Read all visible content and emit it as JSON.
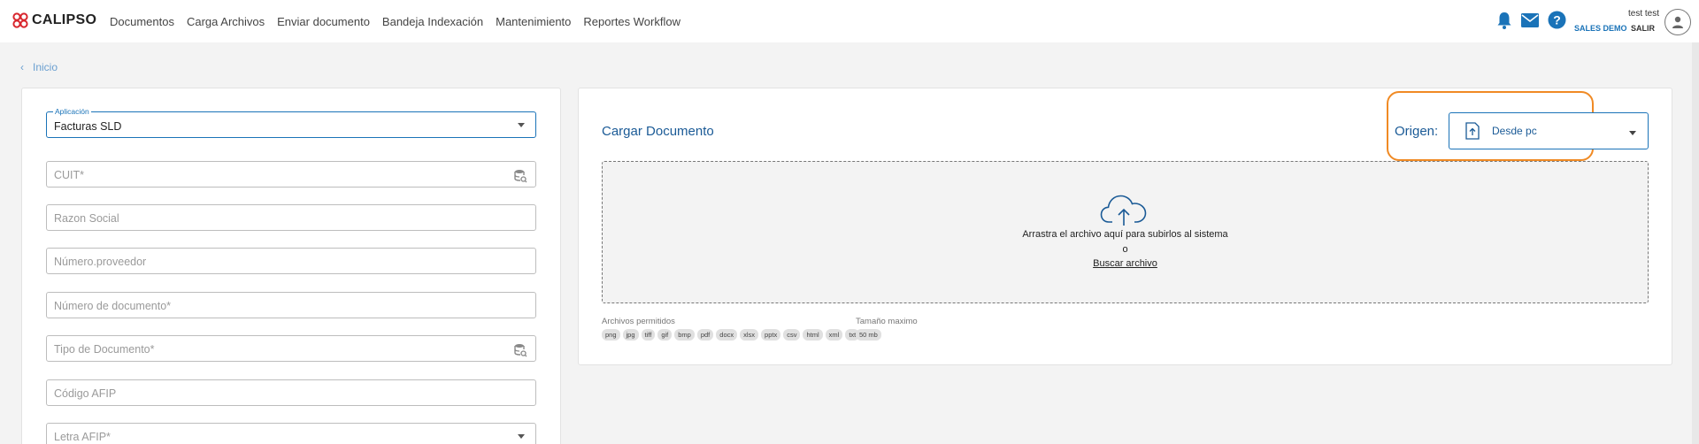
{
  "header": {
    "brand": "CALIPSO",
    "nav": [
      "Documentos",
      "Carga Archivos",
      "Enviar documento",
      "Bandeja Indexación",
      "Mantenimiento",
      "Reportes Workflow"
    ],
    "icons": [
      "bell-icon",
      "mail-icon",
      "help-icon"
    ],
    "user_name": "test test",
    "company": "SALES DEMO",
    "logout": "SALIR",
    "accent_color": "#1a73b8"
  },
  "breadcrumb": {
    "label": "Inicio"
  },
  "form": {
    "application": {
      "label": "Aplicación",
      "value": "Facturas SLD"
    },
    "fields": [
      {
        "placeholder": "CUIT*",
        "icon": "database-search-icon"
      },
      {
        "placeholder": "Razon Social"
      },
      {
        "placeholder": "Número.proveedor"
      },
      {
        "placeholder": "Número de documento*"
      },
      {
        "placeholder": "Tipo de Documento*",
        "icon": "database-search-icon"
      },
      {
        "placeholder": "Código AFIP"
      },
      {
        "placeholder": "Letra AFIP*",
        "icon": "chevron-down-icon"
      }
    ]
  },
  "upload": {
    "title": "Cargar Documento",
    "origin_label": "Origen:",
    "origin_value": "Desde pc",
    "highlight_color": "#f08a24",
    "drop_text": "Arrastra el archivo aquí para subirlos al sistema",
    "or_text": "o",
    "browse_link": "Buscar archivo",
    "allowed_label": "Archivos permitidos",
    "allowed_types": [
      "png",
      "jpg",
      "tiff",
      "gif",
      "bmp",
      "pdf",
      "docx",
      "xlsx",
      "pptx",
      "csv",
      "html",
      "xml",
      "txt"
    ],
    "max_size_label": "Tamaño maximo",
    "max_size": "50 mb"
  }
}
